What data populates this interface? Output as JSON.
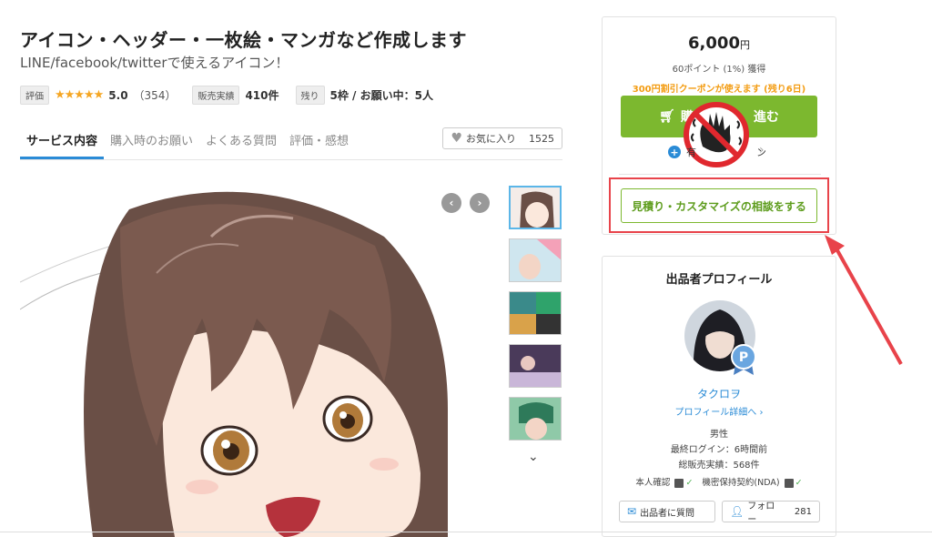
{
  "header": {
    "title": "アイコン・ヘッダー・一枚絵・マンガなど作成します",
    "subtitle": "LINE/facebook/twitterで使えるアイコン！"
  },
  "meta": {
    "rating_tag": "評価",
    "stars": "★★★★★",
    "rating": "5.0",
    "review_count": "（354）",
    "sales_tag": "販売実績",
    "sales_count": "410件",
    "slots_tag": "残り",
    "slots_value": "5枠 / お願い中：5人"
  },
  "tabs": [
    {
      "label": "サービス内容",
      "active": true
    },
    {
      "label": "購入時のお願い"
    },
    {
      "label": "よくある質問"
    },
    {
      "label": "評価・感想"
    }
  ],
  "favorite": {
    "label": "お気に入り",
    "count": "1525"
  },
  "gallery": {
    "prev_icon": "chevron-left-icon",
    "next_icon": "chevron-right-icon",
    "more_icon": "chevron-down-icon"
  },
  "purchase": {
    "price": "6,000",
    "price_unit": "円",
    "points": "60ポイント (1%) 獲得",
    "coupon": "300円割引クーポンが使えます (残り6日)",
    "buy_label_left": "購",
    "buy_label_right": "進む",
    "sub_label_left": "有",
    "sub_label_right": "ン",
    "consult_label": "見積り・カスタマイズの相談をする",
    "accent_color": "#7cb82f",
    "highlight_color": "#e8434a"
  },
  "profile": {
    "title": "出品者プロフィール",
    "name": "タクロヲ",
    "detail_link": "プロフィール詳細へ",
    "gender": "男性",
    "last_login": "最終ログイン：6時間前",
    "total_sales": "総販売実績：568件",
    "identity": "本人確認",
    "nda": "機密保持契約(NDA)",
    "ask_label": "出品者に質問",
    "follow_label": "フォロー",
    "follow_count": "281"
  }
}
